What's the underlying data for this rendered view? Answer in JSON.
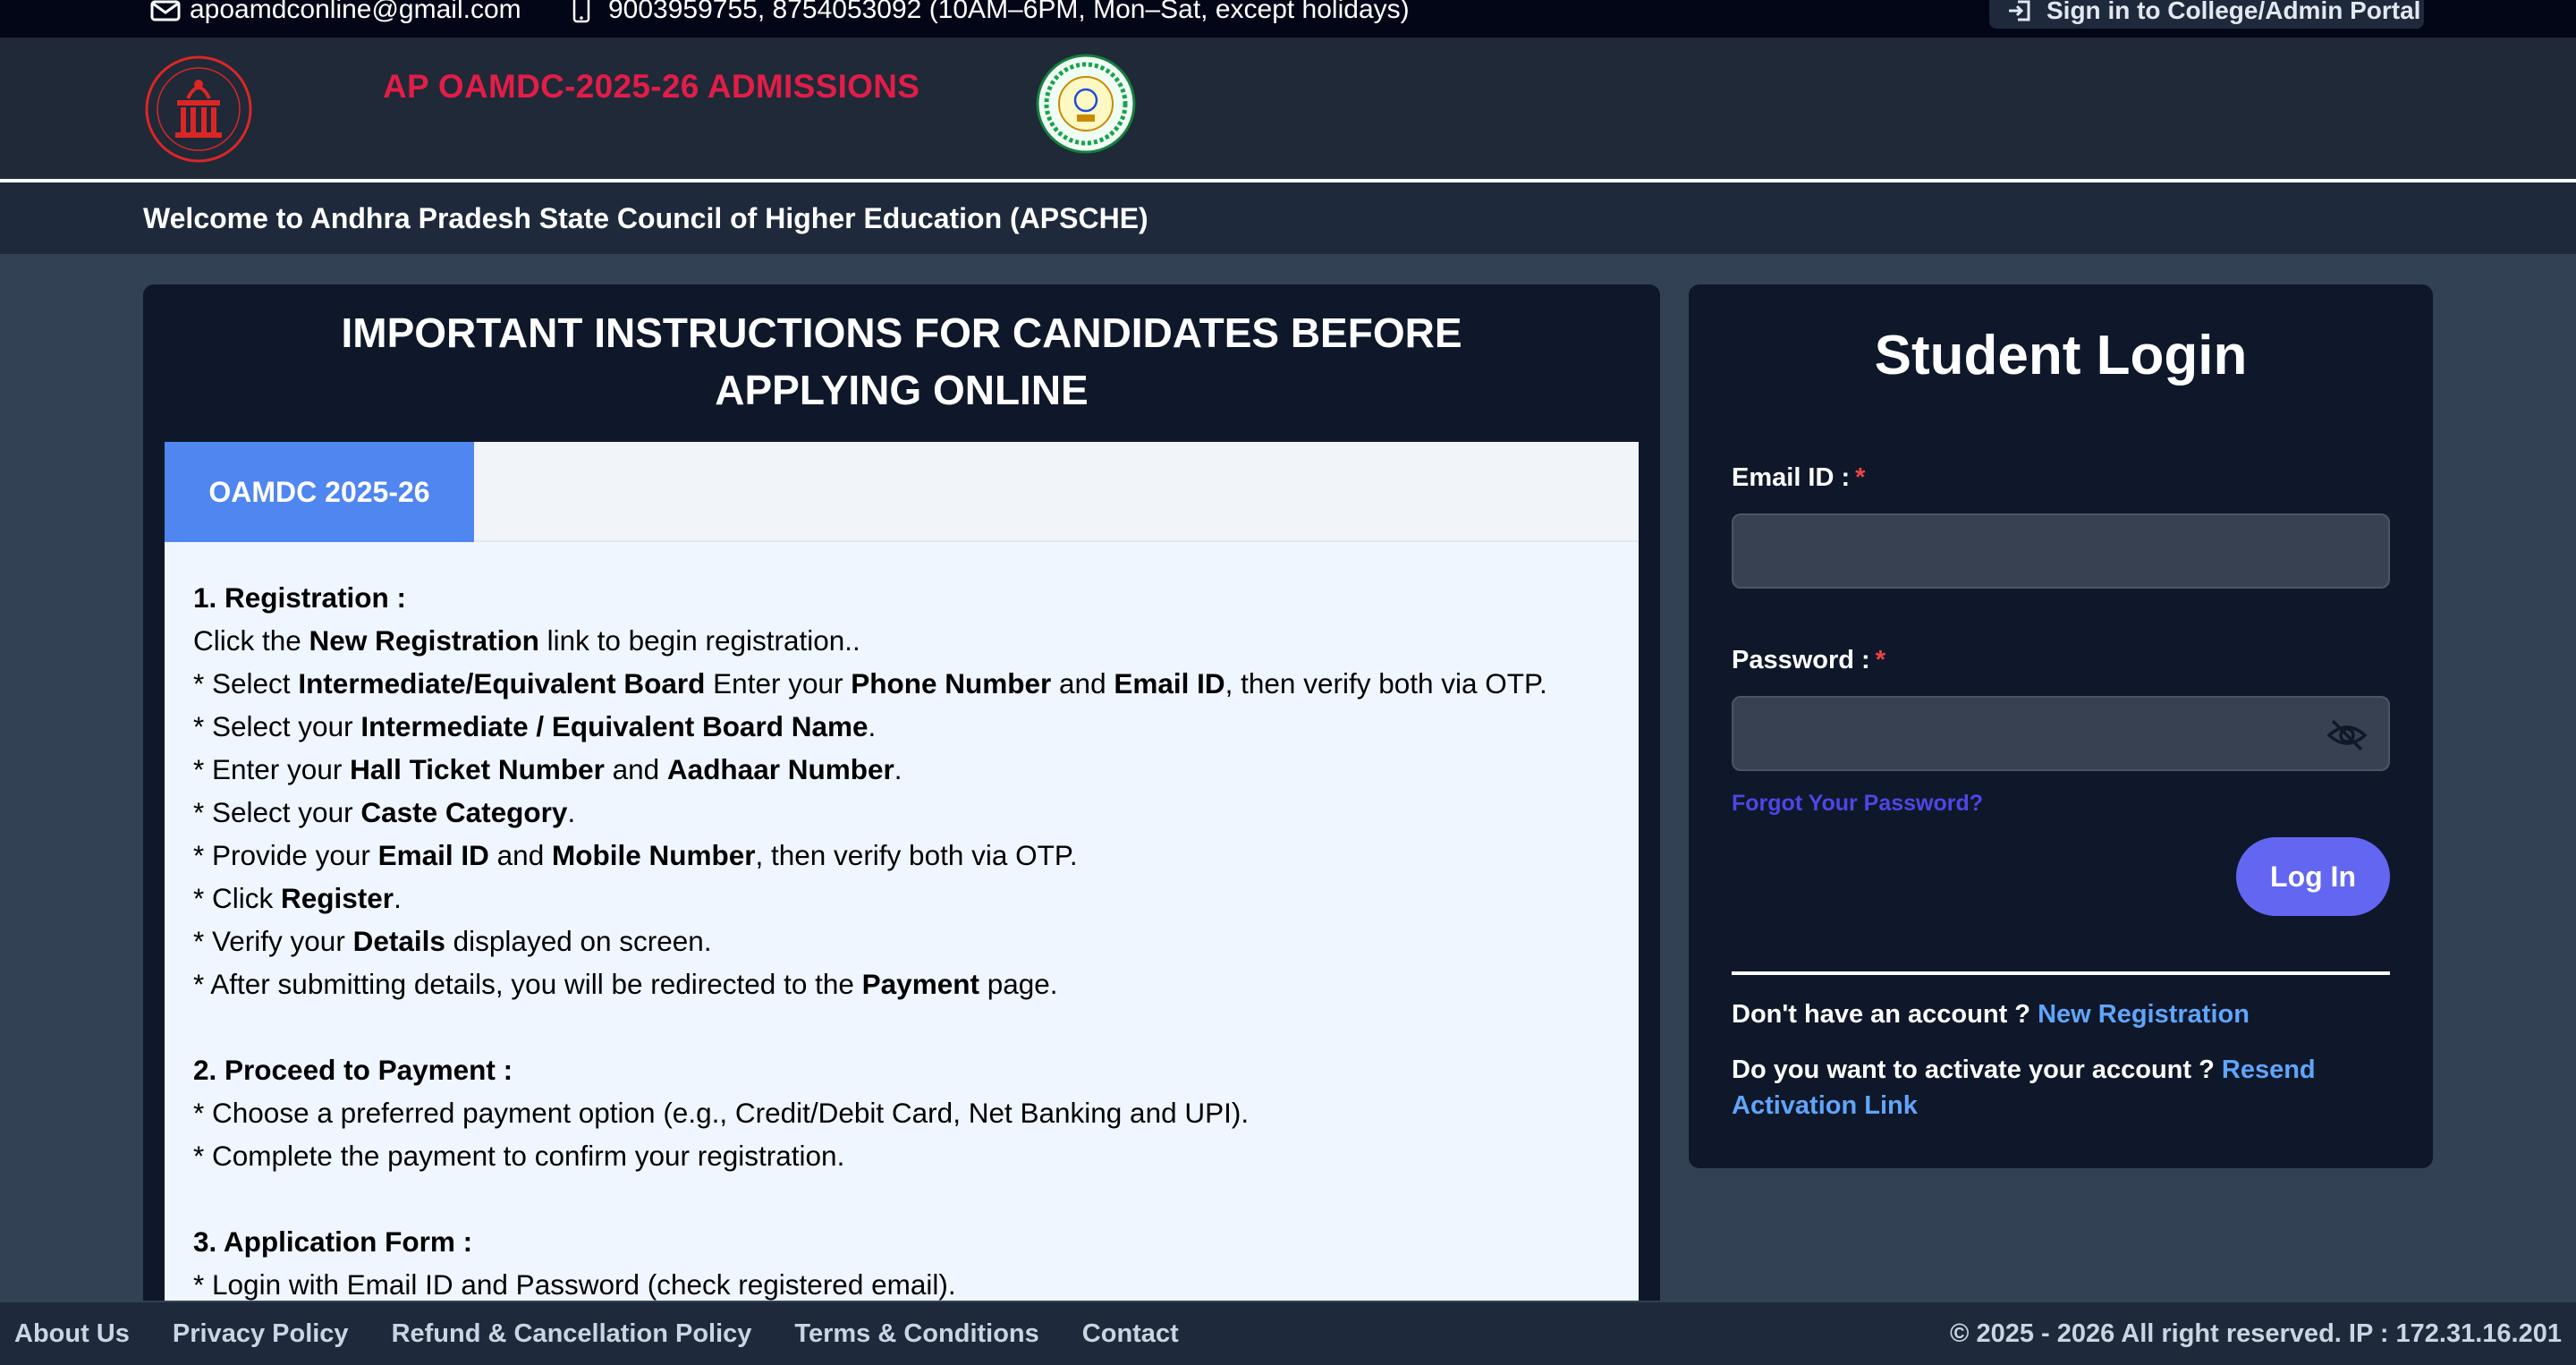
{
  "topbar": {
    "email": "apoamdconline@gmail.com",
    "phone": "9003959755, 8754053092 (10AM–6PM, Mon–Sat, except holidays)",
    "portal_button": "Sign in to College/Admin Portal"
  },
  "header": {
    "title": "AP OAMDC-2025-26 ADMISSIONS",
    "welcome": "Welcome to Andhra Pradesh State Council of Higher Education (APSCHE)"
  },
  "instructions": {
    "title": "IMPORTANT INSTRUCTIONS FOR CANDIDATES BEFORE APPLYING ONLINE",
    "tab_label": "OAMDC 2025-26",
    "sec1_title": "1. Registration :",
    "sec1_intro_a": "Click the ",
    "sec1_intro_b": "New Registration",
    "sec1_intro_c": " link to begin registration..",
    "l1a": "* Select ",
    "l1b": "Intermediate/Equivalent Board",
    "l1c": " Enter your ",
    "l1d": "Phone Number",
    "l1e": " and ",
    "l1f": "Email ID",
    "l1g": ", then verify both via OTP.",
    "l2a": "* Select your ",
    "l2b": "Intermediate / Equivalent Board Name",
    "l2c": ".",
    "l3a": "* Enter your ",
    "l3b": "Hall Ticket Number",
    "l3c": " and ",
    "l3d": "Aadhaar Number",
    "l3e": ".",
    "l4a": "* Select your ",
    "l4b": "Caste Category",
    "l4c": ".",
    "l5a": "* Provide your ",
    "l5b": "Email ID",
    "l5c": " and ",
    "l5d": "Mobile Number",
    "l5e": ", then verify both via OTP.",
    "l6a": "* Click ",
    "l6b": "Register",
    "l6c": ".",
    "l7a": "* Verify your ",
    "l7b": "Details",
    "l7c": " displayed on screen.",
    "l8a": "* After submitting details, you will be redirected to the ",
    "l8b": "Payment",
    "l8c": " page.",
    "sec2_title": "2. Proceed to Payment :",
    "p1": "* Choose a preferred payment option (e.g., Credit/Debit Card, Net Banking and UPI).",
    "p2": "* Complete the payment to confirm your registration.",
    "sec3_title": "3. Application Form :",
    "a1": "* Login with Email ID and Password (check registered email)."
  },
  "login": {
    "title": "Student Login",
    "email_label": "Email ID :",
    "password_label": "Password :",
    "required_mark": "*",
    "forgot": "Forgot Your Password?",
    "button": "Log In",
    "no_account": "Don't have an account ?",
    "new_registration": "New Registration",
    "activate": "Do you want to activate your account ?",
    "resend": "Resend Activation Link"
  },
  "footer": {
    "links": [
      "About Us",
      "Privacy Policy",
      "Refund & Cancellation Policy",
      "Terms & Conditions",
      "Contact"
    ],
    "copyright": "© 2025 - 2026 All right reserved. IP : 172.31.16.201"
  },
  "colors": {
    "accent": "#6366f1",
    "title_red": "#e11d48",
    "tab_blue": "#4f86f0",
    "link_blue": "#60a5fa"
  }
}
